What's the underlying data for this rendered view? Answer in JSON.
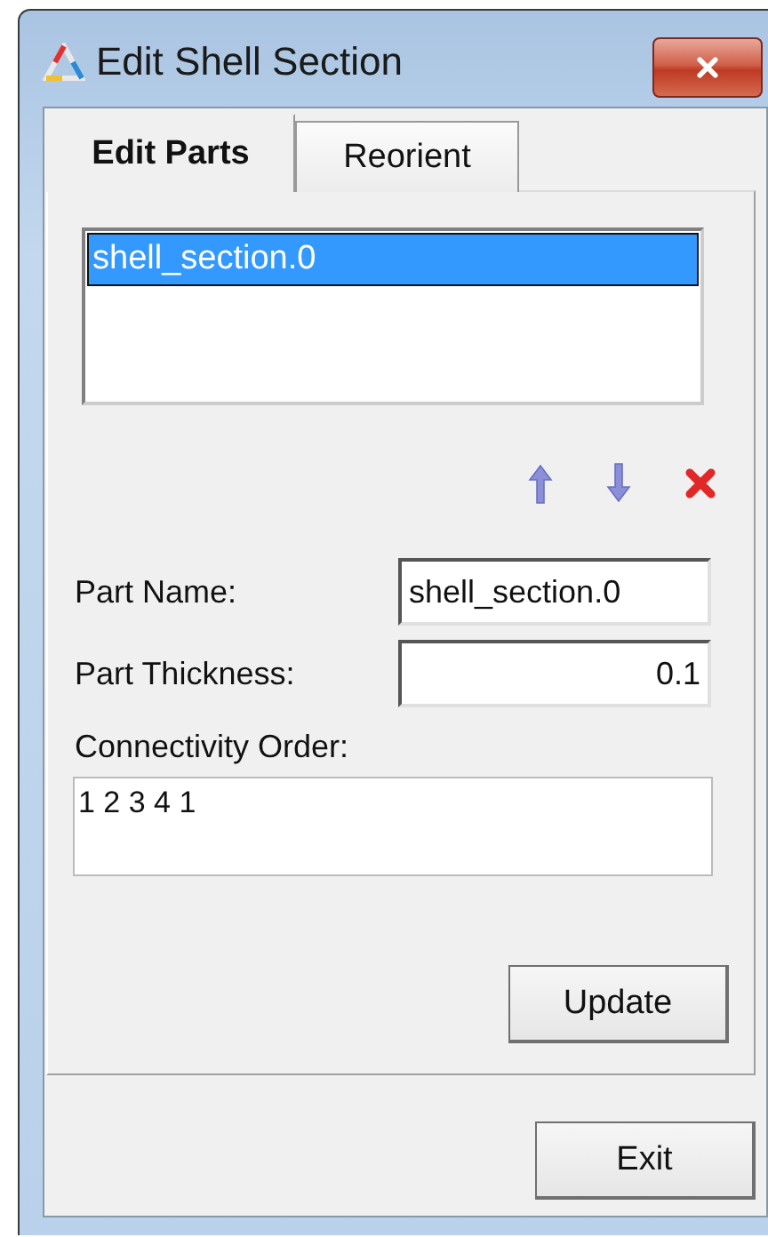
{
  "window": {
    "title": "Edit Shell Section"
  },
  "tabs": [
    {
      "label": "Edit Parts",
      "selected": true
    },
    {
      "label": "Reorient",
      "selected": false
    }
  ],
  "parts_list": [
    {
      "label": "shell_section.0",
      "selected": true
    }
  ],
  "fields": [
    {
      "label": "Part Name:",
      "value": "shell_section.0",
      "kind": "text"
    },
    {
      "label": "Part Thickness:",
      "value": "0.1",
      "kind": "number"
    }
  ],
  "connectivity": {
    "label": "Connectivity Order:",
    "value": "1 2 3 4 1"
  },
  "update_button": "Update",
  "exit_button": "Exit"
}
